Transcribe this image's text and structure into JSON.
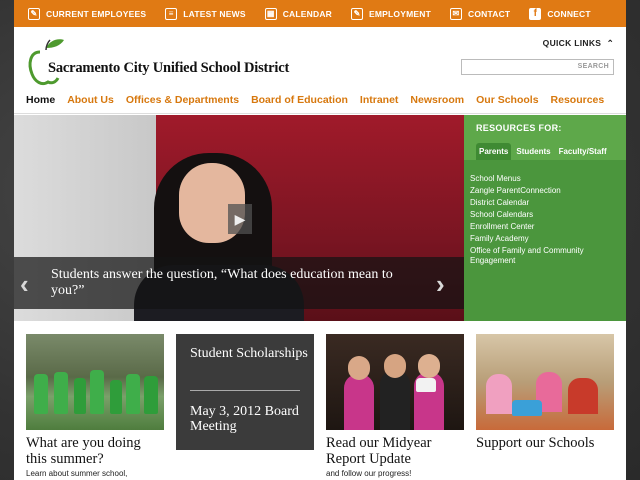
{
  "topbar": {
    "items": [
      {
        "label": "CURRENT EMPLOYEES",
        "icon": "edit-icon"
      },
      {
        "label": "LATEST NEWS",
        "icon": "newspaper-icon"
      },
      {
        "label": "CALENDAR",
        "icon": "calendar-icon"
      },
      {
        "label": "EMPLOYMENT",
        "icon": "edit-icon"
      },
      {
        "label": "CONTACT",
        "icon": "envelope-icon"
      },
      {
        "label": "CONNECT",
        "icon": "facebook-icon"
      }
    ],
    "color": "#e07a14"
  },
  "header": {
    "logo_text": "Sacramento City Unified School District",
    "quick_links": "QUICK LINKS",
    "search_button": "SEARCH",
    "search_placeholder": ""
  },
  "nav": {
    "items": [
      "Home",
      "About Us",
      "Offices & Departments",
      "Board of Education",
      "Intranet",
      "Newsroom",
      "Our Schools",
      "Resources"
    ],
    "accent": "#d7780e"
  },
  "hero": {
    "caption": "Students answer the question, “What does education mean to you?”"
  },
  "resources": {
    "title": "RESOURCES FOR:",
    "tabs": [
      "Parents",
      "Students",
      "Faculty/Staff"
    ],
    "active_tab": "Parents",
    "links": [
      "School Menus",
      "Zangle ParentConnection",
      "District Calendar",
      "School Calendars",
      "Enrollment Center",
      "Family Academy",
      "Office of Family and Community Engagement"
    ],
    "color": "#5ea84a"
  },
  "cards": [
    {
      "title": "What are you doing this summer?",
      "sub": "Learn about summer school,"
    },
    {
      "line1": "Student Scholarships",
      "line2": "May 3, 2012 Board Meeting"
    },
    {
      "title": "Read our Midyear Report Update",
      "sub": "and follow our progress!"
    },
    {
      "title": "Support our Schools",
      "sub": ""
    }
  ]
}
